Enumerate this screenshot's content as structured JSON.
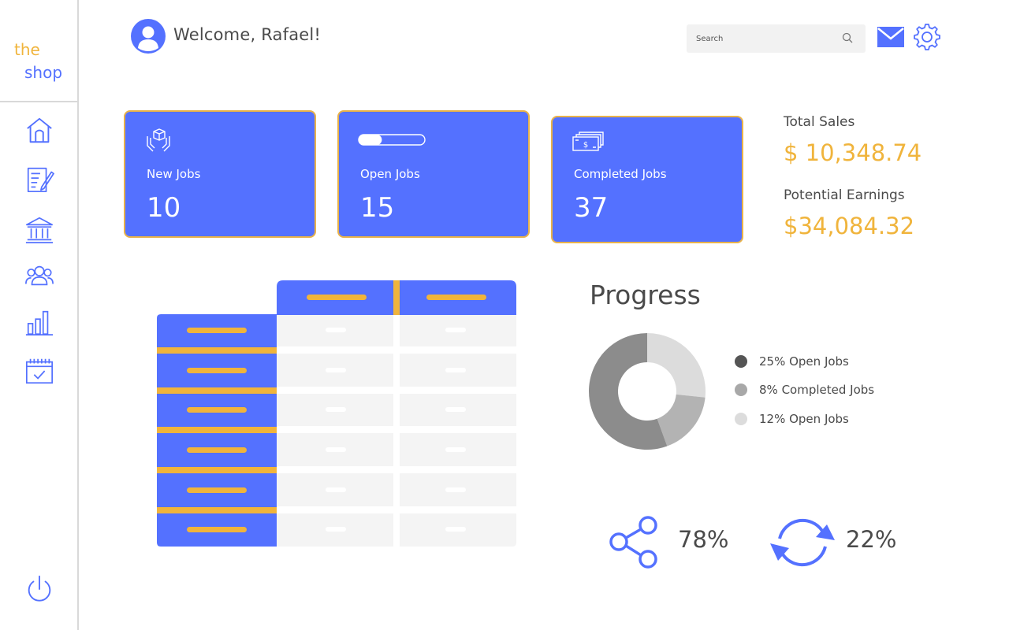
{
  "brand": {
    "line1": "the",
    "line2": "shop"
  },
  "sidebar": {
    "items": [
      {
        "name": "home",
        "icon": "home-icon"
      },
      {
        "name": "orders",
        "icon": "clipboard-pen-icon"
      },
      {
        "name": "bank",
        "icon": "bank-icon"
      },
      {
        "name": "customers",
        "icon": "users-icon"
      },
      {
        "name": "reports",
        "icon": "bar-chart-icon"
      },
      {
        "name": "calendar",
        "icon": "calendar-check-icon"
      }
    ],
    "power_icon": "power-icon"
  },
  "header": {
    "welcome": "Welcome, Rafael!",
    "search_placeholder": "Search"
  },
  "cards": [
    {
      "label": "New Jobs",
      "value": "10",
      "icon": "box-in-hands-icon"
    },
    {
      "label": "Open Jobs",
      "value": "15",
      "icon": "progress-bar-icon",
      "progress": 0.35
    },
    {
      "label": "Completed Jobs",
      "value": "37",
      "icon": "cash-stack-icon"
    }
  ],
  "sales": {
    "total_label": "Total Sales",
    "total_value": "$ 10,348.74",
    "potential_label": "Potential Earnings",
    "potential_value": "$34,084.32"
  },
  "progress": {
    "title": "Progress",
    "legend": [
      {
        "text": "25% Open Jobs",
        "color": "#555555"
      },
      {
        "text": "8% Completed Jobs",
        "color": "#a8a8a8"
      },
      {
        "text": "12% Open Jobs",
        "color": "#dcdcdc"
      }
    ]
  },
  "chart_data": {
    "type": "pie",
    "categories": [
      "Open Jobs",
      "Completed Jobs",
      "Open Jobs"
    ],
    "values": [
      25,
      8,
      12
    ],
    "colors": [
      "#8c8c8c",
      "#b3b3b3",
      "#dcdcdc"
    ]
  },
  "stats": {
    "share_value": "78%",
    "refresh_value": "22%"
  },
  "colors": {
    "accent": "#5471ff",
    "gold": "#f0b43c"
  }
}
